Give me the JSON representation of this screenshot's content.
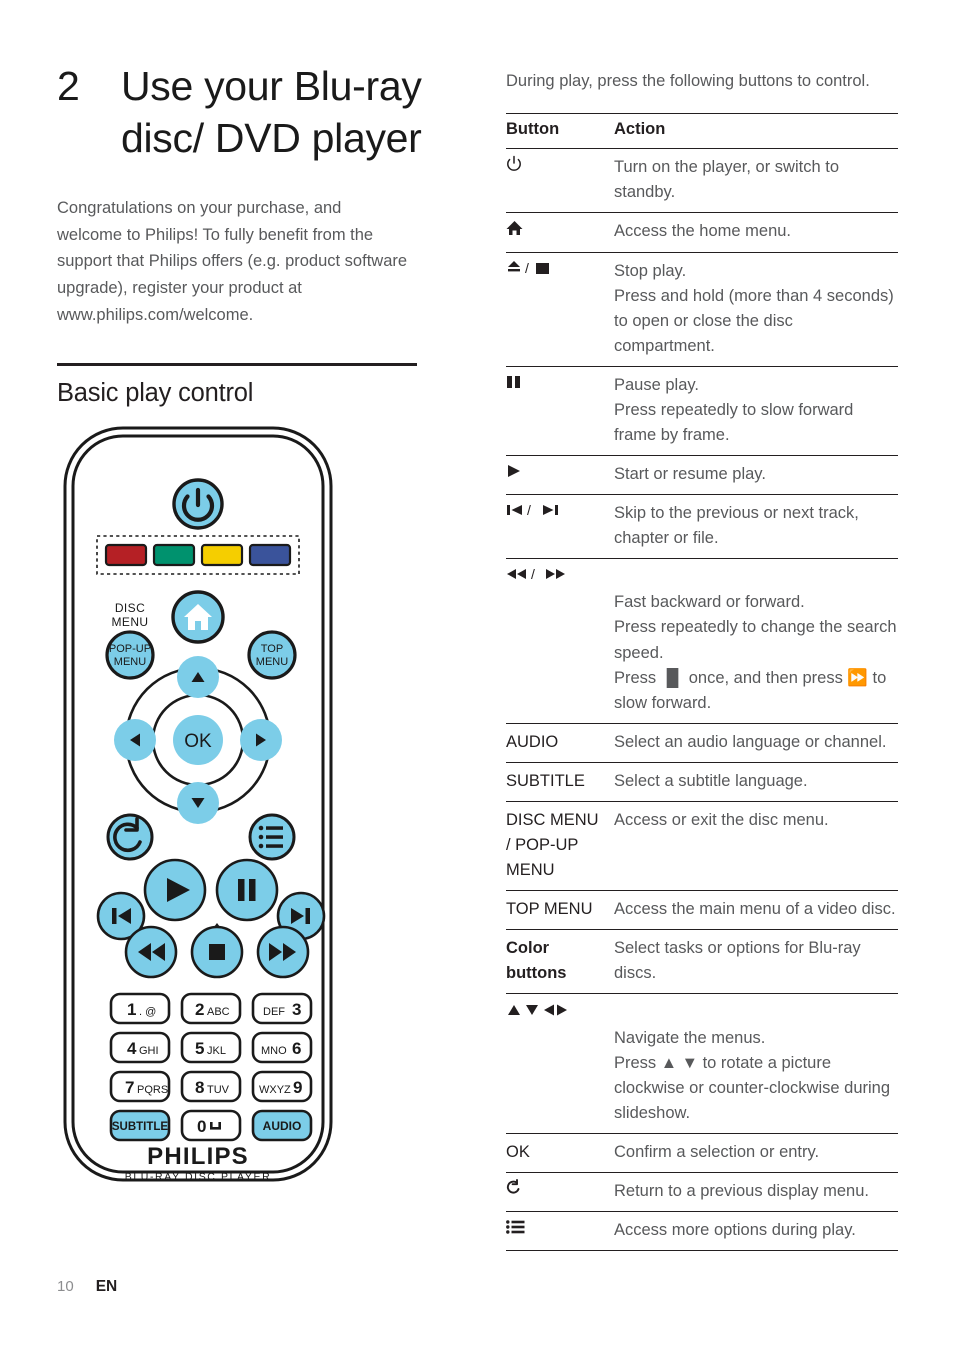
{
  "chapter": {
    "number": "2",
    "title": "Use your Blu-ray disc/ DVD player",
    "intro": "Congratulations on your purchase, and welcome to Philips! To fully benefit from the support that Philips offers (e.g. product software upgrade), register your product at www.philips.com/welcome."
  },
  "section": {
    "title": "Basic play control"
  },
  "right": {
    "lead": "During play, press the following buttons to control.",
    "table": {
      "headers": [
        "Button",
        "Action"
      ],
      "rows": [
        {
          "button": "⏻",
          "button_kind": "glyph",
          "action": "Turn on the player, or switch to standby."
        },
        {
          "button": "⌂",
          "button_kind": "glyph",
          "action": "Access the home menu."
        },
        {
          "button": "⏏ / ■",
          "button_kind": "glyph",
          "action": "Stop play.\nPress and hold (more than 4 seconds) to open or close the disc compartment."
        },
        {
          "button": "▐▌",
          "button_kind": "glyph",
          "action": "Pause play.\nPress repeatedly to slow forward frame by frame."
        },
        {
          "button": "▶",
          "button_kind": "glyph",
          "action": "Start or resume play."
        },
        {
          "button": "⏮ / ⏭",
          "button_kind": "glyph",
          "action": "Skip to the previous or next track, chapter or file."
        },
        {
          "button": "⏪ / ⏩",
          "button_kind": "glyph",
          "action": "Fast backward or forward.\nPress repeatedly to change the search speed.\nPress ▐▌ once, and then press ⏩ to slow forward."
        },
        {
          "button": "AUDIO",
          "button_kind": "text",
          "action": "Select an audio language or channel."
        },
        {
          "button": "SUBTITLE",
          "button_kind": "text",
          "action": "Select a subtitle language."
        },
        {
          "button": "DISC MENU / POP-UP MENU",
          "button_kind": "text",
          "action": "Access or exit the disc menu."
        },
        {
          "button": "TOP MENU",
          "button_kind": "text",
          "action": "Access the main menu of a video disc."
        },
        {
          "button": "Color buttons",
          "button_kind": "text-bold",
          "action": "Select tasks or options for Blu-ray discs."
        },
        {
          "button": "▲ ▼ ◀▶",
          "button_kind": "glyph",
          "action": "Navigate the menus.\nPress ▲ ▼ to rotate a picture clockwise or counter-clockwise during slideshow."
        },
        {
          "button": "OK",
          "button_kind": "text",
          "action": "Confirm a selection or entry."
        },
        {
          "button": "↶",
          "button_kind": "glyph",
          "action": "Return to a previous display menu."
        },
        {
          "button": "☰",
          "button_kind": "glyph",
          "action": "Access more options during play."
        }
      ]
    }
  },
  "remote": {
    "brand": "PHILIPS",
    "subbrand": "BLU-RAY DISC PLAYER",
    "labels": {
      "disc_menu": "DISC MENU",
      "popup_menu_line1": "POP-UP",
      "popup_menu_line2": "MENU",
      "top_menu_line1": "TOP",
      "top_menu_line2": "MENU",
      "ok": "OK"
    },
    "color_buttons": [
      {
        "name": "red-button",
        "color": "#b52025"
      },
      {
        "name": "green-button",
        "color": "#00926e"
      },
      {
        "name": "yellow-button",
        "color": "#f5ce00"
      },
      {
        "name": "blue-button",
        "color": "#3a539b"
      }
    ],
    "keypad": [
      {
        "num": "1",
        "letters": ". @"
      },
      {
        "num": "2",
        "letters": "ABC"
      },
      {
        "num": "3",
        "letters": "DEF",
        "reverse": true
      },
      {
        "num": "4",
        "letters": "GHI"
      },
      {
        "num": "5",
        "letters": "JKL"
      },
      {
        "num": "6",
        "letters": "MNO",
        "reverse": true
      },
      {
        "num": "7",
        "letters": "PQRS"
      },
      {
        "num": "8",
        "letters": "TUV"
      },
      {
        "num": "9",
        "letters": "WXYZ",
        "reverse": true
      }
    ],
    "bottom_keys": [
      {
        "label": "SUBTITLE",
        "highlight": true
      },
      {
        "label": "0",
        "letters": "⌴",
        "highlight": false
      },
      {
        "label": "AUDIO",
        "highlight": true
      }
    ],
    "accent": "#7ccde8",
    "outline": "#1a1a1a"
  },
  "footer": {
    "page": "10",
    "lang": "EN"
  }
}
